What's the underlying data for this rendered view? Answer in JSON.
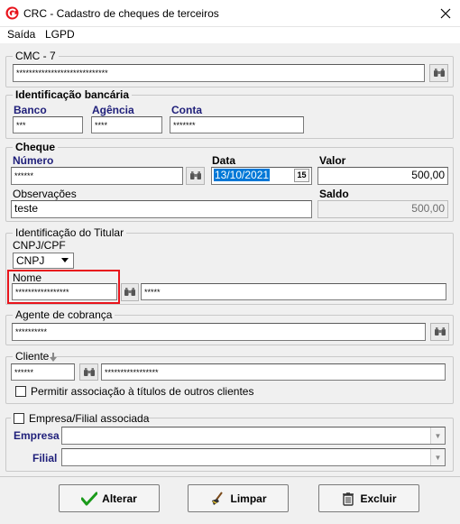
{
  "window": {
    "title": "CRC - Cadastro de cheques de terceiros"
  },
  "menu": {
    "items": [
      "Saída",
      "LGPD"
    ]
  },
  "cmc7": {
    "legend": "CMC - 7",
    "value": "*****************************"
  },
  "bank": {
    "legend": "Identificação bancária",
    "banco_label": "Banco",
    "banco_value": "***",
    "agencia_label": "Agência",
    "agencia_value": "****",
    "conta_label": "Conta",
    "conta_value": "*******"
  },
  "cheque": {
    "legend": "Cheque",
    "numero_label": "Número",
    "numero_value": "******",
    "data_label": "Data",
    "data_value": "13/10/2021",
    "calendar_label": "15",
    "valor_label": "Valor",
    "valor_value": "500,00",
    "obs_label": "Observações",
    "obs_value": "teste",
    "saldo_label": "Saldo",
    "saldo_value": "500,00"
  },
  "titular": {
    "legend": "Identificação do Titular",
    "cnpj_label": "CNPJ/CPF",
    "cnpj_select": "CNPJ",
    "nome_label": "Nome",
    "nome_value": "*****************",
    "code_value": "*****"
  },
  "agente": {
    "legend": "Agente de cobrança",
    "value": "**********"
  },
  "cliente": {
    "legend": "Cliente",
    "code_value": "******",
    "name_value": "*****************",
    "permit_label": "Permitir associação à títulos de outros clientes"
  },
  "empresa": {
    "legend": "Empresa/Filial associada",
    "empresa_label": "Empresa",
    "filial_label": "Filial"
  },
  "buttons": {
    "alterar": "Alterar",
    "limpar": "Limpar",
    "excluir": "Excluir"
  },
  "colors": {
    "accent": "#e8141c",
    "selection": "#0078d7",
    "label_blue": "#1f1f7a",
    "ok_green": "#1a9a1a"
  }
}
